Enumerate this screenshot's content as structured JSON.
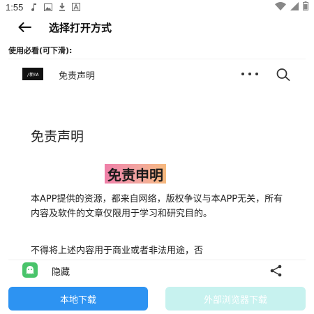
{
  "status_bar": {
    "time": "1:55",
    "icons": [
      "music-note-icon",
      "image-icon",
      "download-icon",
      "a-icon"
    ],
    "right_icons": [
      "wifi-icon",
      "signal-icon",
      "battery-icon"
    ]
  },
  "app_bar": {
    "title": "选择打开方式"
  },
  "hint": "使用必看(可下滑):",
  "card": {
    "logo_text": "/新©A",
    "header_title": "免责声明",
    "article_title": "免责声明",
    "banner_text": "免责申明",
    "paragraphs": [
      "本APP提供的资源，都来自网络，版权争议与本APP无关，所有内容及软件的文章仅限用于学习和研究目的。",
      "不得将上述内容用于商业或者非法用途，否"
    ]
  },
  "share_row": {
    "label": "隐藏"
  },
  "buttons": {
    "local_download": "本地下载",
    "browser_download": "外部浏览器下载"
  },
  "colors": {
    "primary": "#2d93f2",
    "secondary_disabled": "#c7f2ef",
    "app_icon": "#49c46b",
    "banner_gradient": [
      "#ef7fa8",
      "#f6b97d"
    ]
  }
}
